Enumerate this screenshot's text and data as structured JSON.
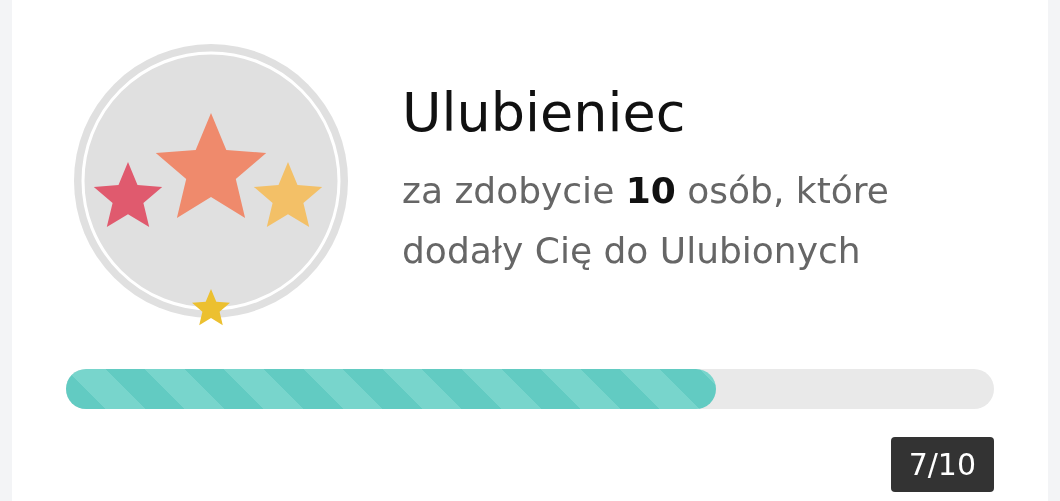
{
  "badge": {
    "title": "Ulubieniec",
    "description": "za zdobycie **10** osób, które dodały Cię do Ulubionych",
    "earned": true
  },
  "progress": {
    "level": 0.7,
    "reading": "7/10"
  }
}
